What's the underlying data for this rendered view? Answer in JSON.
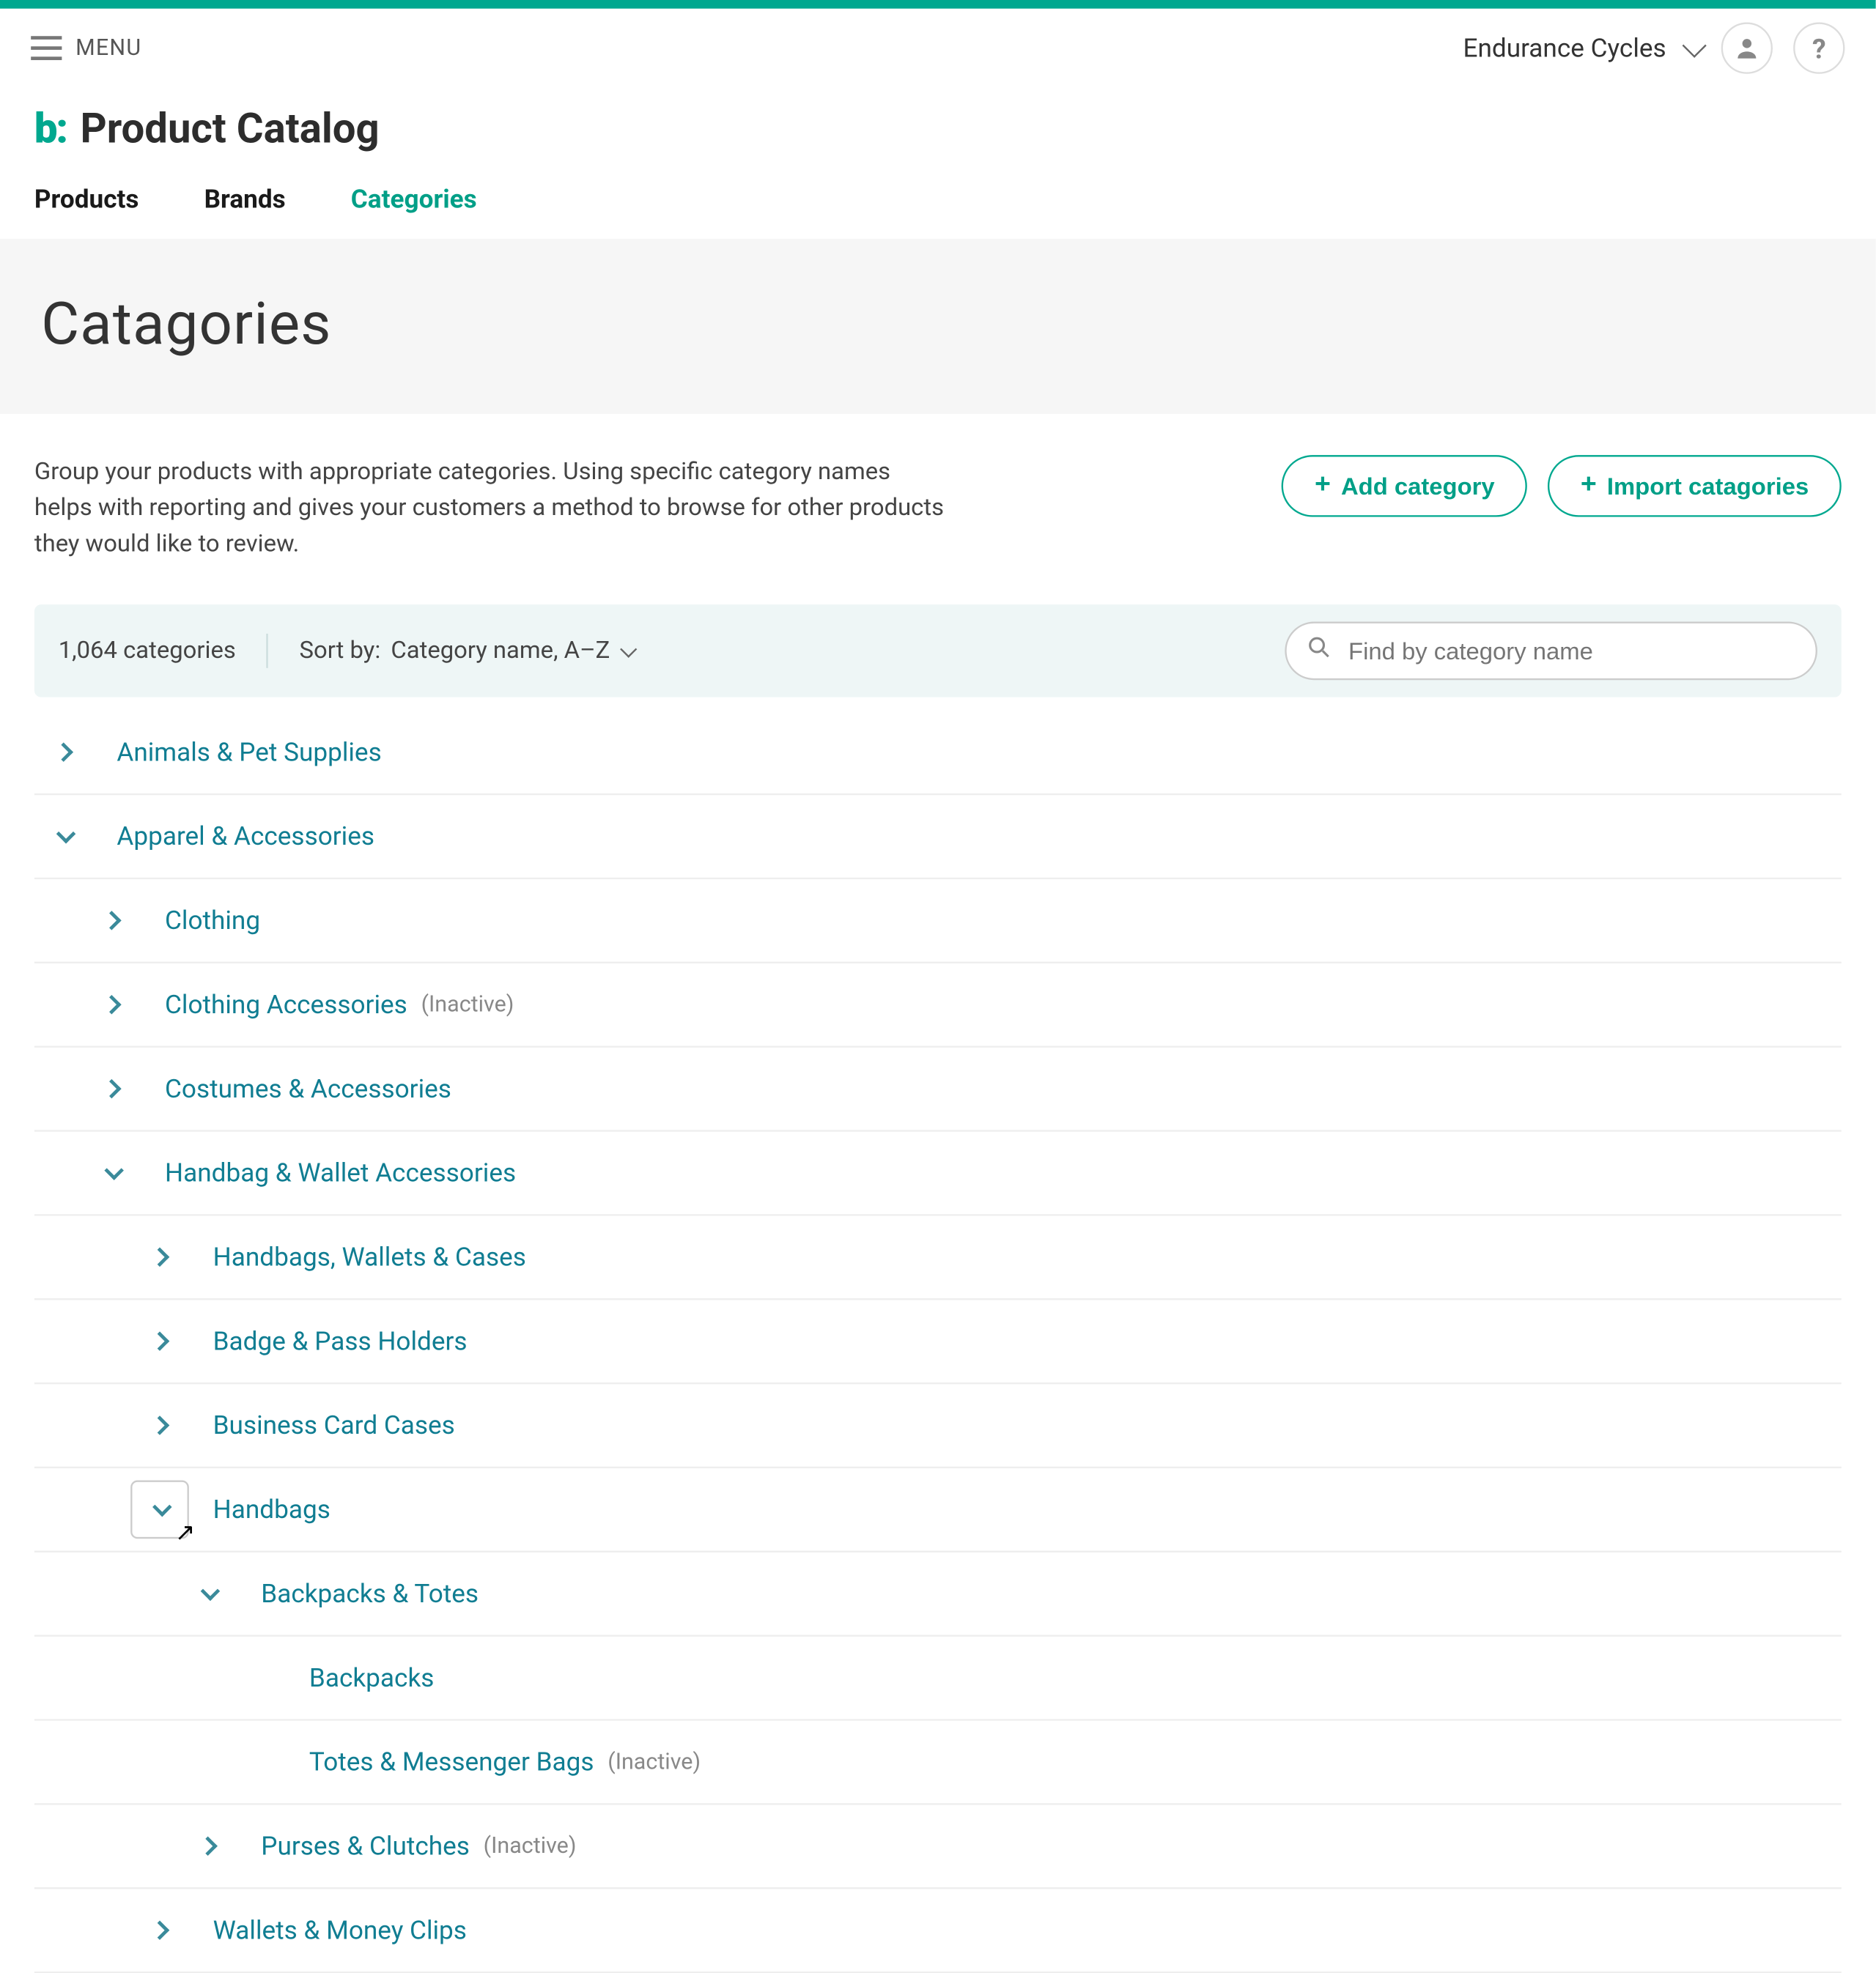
{
  "header": {
    "menu_label": "MENU",
    "org_name": "Endurance Cycles"
  },
  "page": {
    "brand_mark": "b:",
    "title": "Product Catalog",
    "subtitle": "Catagories"
  },
  "tabs": {
    "products": "Products",
    "brands": "Brands",
    "categories": "Categories",
    "active": "categories"
  },
  "description": "Group your products with appropriate categories. Using specific category names helps with reporting and gives your customers a method to browse for other products they would like to review.",
  "actions": {
    "add": "Add category",
    "import": "Import catagories"
  },
  "toolbar": {
    "count_text": "1,064 categories",
    "sort_label": "Sort by:",
    "sort_value": "Category name, A–Z",
    "search_placeholder": "Find by category name"
  },
  "inactive_label": "(Inactive)",
  "tree": [
    {
      "level": 0,
      "label": "Animals & Pet Supplies",
      "expanded": false,
      "has_children": true
    },
    {
      "level": 0,
      "label": "Apparel & Accessories",
      "expanded": true,
      "has_children": true
    },
    {
      "level": 1,
      "label": "Clothing",
      "expanded": false,
      "has_children": true
    },
    {
      "level": 1,
      "label": "Clothing Accessories",
      "expanded": false,
      "has_children": true,
      "inactive": true
    },
    {
      "level": 1,
      "label": "Costumes & Accessories",
      "expanded": false,
      "has_children": true
    },
    {
      "level": 1,
      "label": "Handbag & Wallet Accessories",
      "expanded": true,
      "has_children": true
    },
    {
      "level": 2,
      "label": "Handbags, Wallets & Cases",
      "expanded": false,
      "has_children": true
    },
    {
      "level": 2,
      "label": "Badge & Pass Holders",
      "expanded": false,
      "has_children": true
    },
    {
      "level": 2,
      "label": "Business Card Cases",
      "expanded": false,
      "has_children": true
    },
    {
      "level": 2,
      "label": "Handbags",
      "expanded": true,
      "has_children": true,
      "boxed": true,
      "cursor": true
    },
    {
      "level": 3,
      "label": "Backpacks & Totes",
      "expanded": true,
      "has_children": true
    },
    {
      "level": 4,
      "label": "Backpacks",
      "expanded": false,
      "has_children": false
    },
    {
      "level": 4,
      "label": "Totes & Messenger Bags",
      "expanded": false,
      "has_children": false,
      "inactive": true
    },
    {
      "level": 3,
      "label": "Purses & Clutches",
      "expanded": false,
      "has_children": true,
      "inactive": true
    },
    {
      "level": 2,
      "label": "Wallets & Money Clips",
      "expanded": false,
      "has_children": true
    }
  ]
}
